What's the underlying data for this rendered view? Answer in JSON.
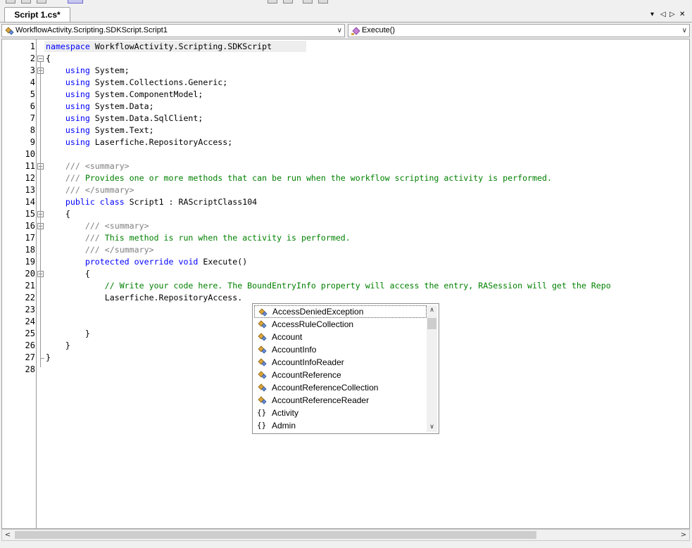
{
  "tab": {
    "title": "Script 1.cs*"
  },
  "tab_controls": {
    "dropdown": "▾",
    "prev": "◁",
    "next": "▷",
    "close": "✕"
  },
  "navbar": {
    "class_combo": {
      "value": "WorkflowActivity.Scripting.SDKScript.Script1",
      "icon": "class-icon"
    },
    "member_combo": {
      "value": "Execute()",
      "icon": "method-icon"
    }
  },
  "editor": {
    "line_numbers": [
      "1",
      "2",
      "3",
      "4",
      "5",
      "6",
      "7",
      "8",
      "9",
      "10",
      "11",
      "12",
      "13",
      "14",
      "15",
      "16",
      "17",
      "18",
      "19",
      "20",
      "21",
      "22",
      "23",
      "24",
      "25",
      "26",
      "27",
      "28"
    ],
    "lines": [
      [
        {
          "t": "namespace",
          "c": "kw"
        },
        {
          "t": " WorkflowActivity.Scripting.SDKScript",
          "c": ""
        }
      ],
      [
        {
          "t": "{",
          "c": ""
        }
      ],
      [
        {
          "t": "    ",
          "c": ""
        },
        {
          "t": "using",
          "c": "kw"
        },
        {
          "t": " System;",
          "c": ""
        }
      ],
      [
        {
          "t": "    ",
          "c": ""
        },
        {
          "t": "using",
          "c": "kw"
        },
        {
          "t": " System.Collections.Generic;",
          "c": ""
        }
      ],
      [
        {
          "t": "    ",
          "c": ""
        },
        {
          "t": "using",
          "c": "kw"
        },
        {
          "t": " System.ComponentModel;",
          "c": ""
        }
      ],
      [
        {
          "t": "    ",
          "c": ""
        },
        {
          "t": "using",
          "c": "kw"
        },
        {
          "t": " System.Data;",
          "c": ""
        }
      ],
      [
        {
          "t": "    ",
          "c": ""
        },
        {
          "t": "using",
          "c": "kw"
        },
        {
          "t": " System.Data.SqlClient;",
          "c": ""
        }
      ],
      [
        {
          "t": "    ",
          "c": ""
        },
        {
          "t": "using",
          "c": "kw"
        },
        {
          "t": " System.Text;",
          "c": ""
        }
      ],
      [
        {
          "t": "    ",
          "c": ""
        },
        {
          "t": "using",
          "c": "kw"
        },
        {
          "t": " Laserfiche.RepositoryAccess;",
          "c": ""
        }
      ],
      [],
      [
        {
          "t": "    ",
          "c": ""
        },
        {
          "t": "/// ",
          "c": "cg"
        },
        {
          "t": "<summary>",
          "c": "cg"
        }
      ],
      [
        {
          "t": "    ",
          "c": ""
        },
        {
          "t": "/// ",
          "c": "cg"
        },
        {
          "t": "Provides one or more methods that can be run when the workflow scripting activity is performed.",
          "c": "cm"
        }
      ],
      [
        {
          "t": "    ",
          "c": ""
        },
        {
          "t": "/// ",
          "c": "cg"
        },
        {
          "t": "</summary>",
          "c": "cg"
        }
      ],
      [
        {
          "t": "    ",
          "c": ""
        },
        {
          "t": "public",
          "c": "kw"
        },
        {
          "t": " ",
          "c": ""
        },
        {
          "t": "class",
          "c": "kw"
        },
        {
          "t": " Script1 : RAScriptClass104",
          "c": ""
        }
      ],
      [
        {
          "t": "    {",
          "c": ""
        }
      ],
      [
        {
          "t": "        ",
          "c": ""
        },
        {
          "t": "/// ",
          "c": "cg"
        },
        {
          "t": "<summary>",
          "c": "cg"
        }
      ],
      [
        {
          "t": "        ",
          "c": ""
        },
        {
          "t": "/// ",
          "c": "cg"
        },
        {
          "t": "This method is run when the activity is performed.",
          "c": "cm"
        }
      ],
      [
        {
          "t": "        ",
          "c": ""
        },
        {
          "t": "/// ",
          "c": "cg"
        },
        {
          "t": "</summary>",
          "c": "cg"
        }
      ],
      [
        {
          "t": "        ",
          "c": ""
        },
        {
          "t": "protected",
          "c": "kw"
        },
        {
          "t": " ",
          "c": ""
        },
        {
          "t": "override",
          "c": "kw"
        },
        {
          "t": " ",
          "c": ""
        },
        {
          "t": "void",
          "c": "kw"
        },
        {
          "t": " Execute()",
          "c": ""
        }
      ],
      [
        {
          "t": "        {",
          "c": ""
        }
      ],
      [
        {
          "t": "            ",
          "c": ""
        },
        {
          "t": "// Write your code here. The BoundEntryInfo property will access the entry, RASession will get the Repo",
          "c": "cm"
        }
      ],
      [
        {
          "t": "            Laserfiche.RepositoryAccess.",
          "c": ""
        }
      ],
      [],
      [],
      [
        {
          "t": "        }",
          "c": ""
        }
      ],
      [
        {
          "t": "    }",
          "c": ""
        }
      ],
      [
        {
          "t": "}",
          "c": ""
        }
      ],
      []
    ]
  },
  "intellisense": {
    "items": [
      {
        "label": "AccessDeniedException",
        "icon": "class-icon",
        "selected": true
      },
      {
        "label": "AccessRuleCollection",
        "icon": "class-icon",
        "selected": false
      },
      {
        "label": "Account",
        "icon": "class-icon",
        "selected": false
      },
      {
        "label": "AccountInfo",
        "icon": "class-icon",
        "selected": false
      },
      {
        "label": "AccountInfoReader",
        "icon": "class-icon",
        "selected": false
      },
      {
        "label": "AccountReference",
        "icon": "class-icon",
        "selected": false
      },
      {
        "label": "AccountReferenceCollection",
        "icon": "class-icon",
        "selected": false
      },
      {
        "label": "AccountReferenceReader",
        "icon": "class-icon",
        "selected": false
      },
      {
        "label": "Activity",
        "icon": "namespace-icon",
        "selected": false
      },
      {
        "label": "Admin",
        "icon": "namespace-icon",
        "selected": false
      }
    ],
    "namespace_glyph": "{}"
  },
  "scroll": {
    "up": "▲",
    "down": "▼",
    "left": "<",
    "right": ">"
  },
  "colors": {
    "keyword": "#0000ff",
    "comment": "#008000",
    "doc_tag": "#808080"
  }
}
